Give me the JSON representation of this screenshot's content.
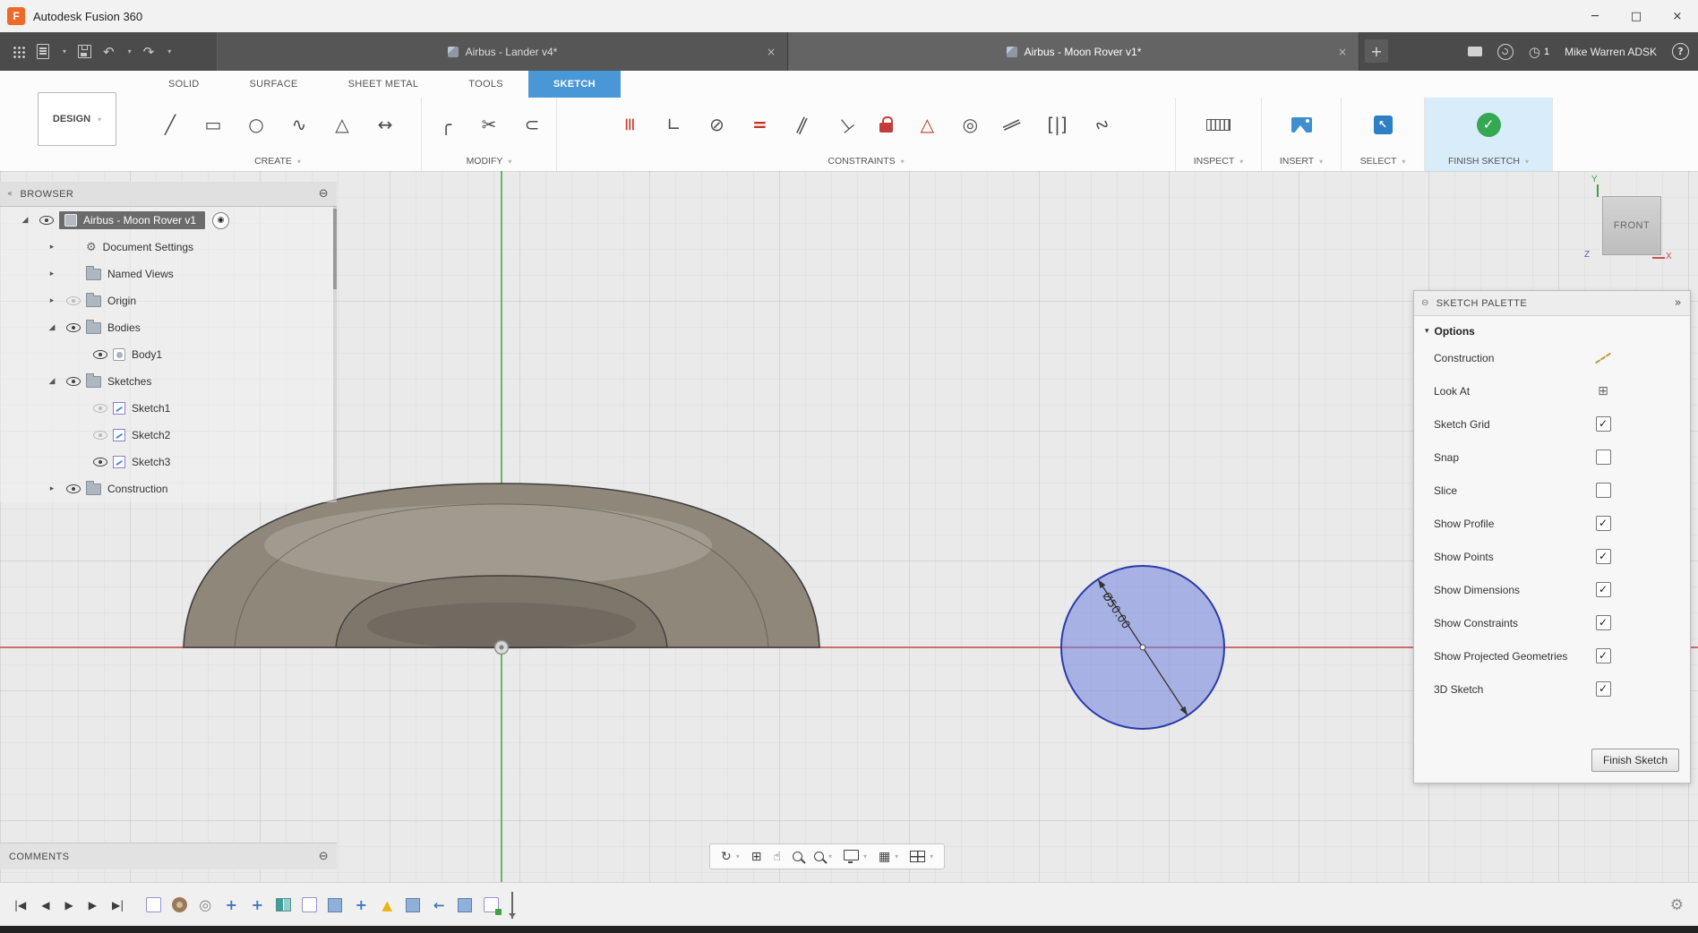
{
  "icons": {
    "minimize": "─",
    "maximize": "□",
    "close": "×",
    "browser_collapse": "«",
    "panel_collapse": "⊖",
    "palette_expand": "»",
    "dropdown_caret": "▾",
    "section_caret": "▾",
    "comments_toggle": "⊖",
    "new_tab": "+",
    "gear": "⚙"
  },
  "titlebar": {
    "logo_letter": "F",
    "app_title": "Autodesk Fusion 360"
  },
  "appbar": {
    "left_icons": [
      {
        "name": "app-launcher-icon",
        "cls": "grid9"
      },
      {
        "name": "file-new-icon",
        "cls": "file",
        "caret": true
      },
      {
        "name": "save-icon",
        "cls": "save"
      },
      {
        "name": "undo-icon",
        "glyph": "↶",
        "caret": true
      },
      {
        "name": "redo-icon",
        "glyph": "↷",
        "caret": true
      }
    ],
    "tabs": [
      {
        "label": "Airbus - Lander v4*",
        "active": false
      },
      {
        "label": "Airbus - Moon Rover v1*",
        "active": true
      }
    ],
    "right_items": [
      {
        "kind": "icon",
        "name": "comments-bubble-icon",
        "cls": "bubble"
      },
      {
        "kind": "icon",
        "name": "extensions-icon",
        "cls": "swoosh"
      },
      {
        "kind": "clock",
        "name": "job-status-icon",
        "glyph": "◷",
        "badge": "1"
      },
      {
        "kind": "user",
        "name": "user-account",
        "label": "Mike Warren ADSK"
      },
      {
        "kind": "help",
        "name": "help-icon",
        "glyph": "?"
      }
    ]
  },
  "ribbon": {
    "design_button": "DESIGN",
    "tabs": [
      {
        "label": "SOLID"
      },
      {
        "label": "SURFACE"
      },
      {
        "label": "SHEET METAL"
      },
      {
        "label": "TOOLS"
      },
      {
        "label": "SKETCH",
        "active": true
      }
    ],
    "groups": [
      {
        "key": "create",
        "label": "CREATE",
        "icons": [
          {
            "name": "line-icon",
            "glyph": "╱"
          },
          {
            "name": "rectangle-icon",
            "glyph": "▭"
          },
          {
            "name": "circle-icon",
            "glyph": "○"
          },
          {
            "name": "spline-icon",
            "glyph": "∿"
          },
          {
            "name": "polygon-icon",
            "glyph": "△"
          },
          {
            "name": "sketch-dimension-icon",
            "glyph": "↔"
          }
        ]
      },
      {
        "key": "modify",
        "label": "MODIFY",
        "icons": [
          {
            "name": "fillet-icon",
            "glyph": "╭"
          },
          {
            "name": "trim-icon",
            "glyph": "✂"
          },
          {
            "name": "offset-icon",
            "glyph": "⊂"
          }
        ]
      },
      {
        "key": "constraints",
        "label": "CONSTRAINTS",
        "icons": [
          {
            "name": "horizontal-vertical-constraint-icon",
            "glyph": "≡",
            "color": "#c0392b",
            "rot": 90
          },
          {
            "name": "coincident-constraint-icon",
            "glyph": "∟"
          },
          {
            "name": "tangent-constraint-icon",
            "glyph": "⊘"
          },
          {
            "name": "equal-constraint-icon",
            "glyph": "=",
            "color": "#c0392b",
            "bold": true
          },
          {
            "name": "parallel-constraint-icon",
            "glyph": "∥",
            "rot": 25
          },
          {
            "name": "perpendicular-constraint-icon",
            "glyph": "⊥",
            "rot": -40
          },
          {
            "name": "fix-constraint-icon",
            "cls": "lock"
          },
          {
            "name": "midpoint-constraint-icon",
            "glyph": "△",
            "color": "#c0392b"
          },
          {
            "name": "concentric-constraint-icon",
            "glyph": "◎"
          },
          {
            "name": "collinear-constraint-icon",
            "glyph": "∥",
            "rot": 65
          },
          {
            "name": "symmetry-constraint-icon",
            "glyph": "[|]"
          },
          {
            "name": "curvature-constraint-icon",
            "glyph": "∿",
            "rot": -45
          }
        ]
      },
      {
        "key": "inspect",
        "label": "INSPECT",
        "icons": [
          {
            "name": "measure-icon",
            "cls": "ruler"
          }
        ]
      },
      {
        "key": "insert",
        "label": "INSERT",
        "icons": [
          {
            "name": "insert-image-icon",
            "cls": "image"
          }
        ]
      },
      {
        "key": "select",
        "label": "SELECT",
        "icons": [
          {
            "name": "select-icon",
            "cls": "select"
          }
        ]
      },
      {
        "key": "finish",
        "label": "FINISH SKETCH",
        "highlight": true,
        "icons": [
          {
            "name": "finish-sketch-icon",
            "cls": "finish"
          }
        ]
      }
    ]
  },
  "browser": {
    "title": "BROWSER",
    "items": [
      {
        "label": "Airbus - Moon Rover v1",
        "depth": 0,
        "arrow": "expanded",
        "eye": "on",
        "icon": "component",
        "selected": true,
        "activate": true
      },
      {
        "label": "Document Settings",
        "depth": 1,
        "arrow": "collapsed",
        "icon": "gear"
      },
      {
        "label": "Named Views",
        "depth": 1,
        "arrow": "collapsed",
        "icon": "folder"
      },
      {
        "label": "Origin",
        "depth": 1,
        "arrow": "collapsed",
        "eye": "off",
        "icon": "folder"
      },
      {
        "label": "Bodies",
        "depth": 1,
        "arrow": "expanded",
        "eye": "on",
        "icon": "folder"
      },
      {
        "label": "Body1",
        "depth": 2,
        "eye": "on",
        "icon": "body"
      },
      {
        "label": "Sketches",
        "depth": 1,
        "arrow": "expanded",
        "eye": "on",
        "icon": "folder"
      },
      {
        "label": "Sketch1",
        "depth": 2,
        "eye": "off",
        "icon": "sketch"
      },
      {
        "label": "Sketch2",
        "depth": 2,
        "eye": "off",
        "icon": "sketch"
      },
      {
        "label": "Sketch3",
        "depth": 2,
        "eye": "on",
        "icon": "sketch"
      },
      {
        "label": "Construction",
        "depth": 1,
        "arrow": "collapsed",
        "eye": "on",
        "icon": "folder"
      }
    ]
  },
  "canvas": {
    "sketch_dimension": "Ø50.00",
    "viewcube_face": "FRONT",
    "axis_labels": {
      "x": "X",
      "y": "Y",
      "z": "Z"
    }
  },
  "palette": {
    "title": "SKETCH PALETTE",
    "section": "Options",
    "rows": [
      {
        "label": "Construction",
        "control": "construction-icon"
      },
      {
        "label": "Look At",
        "control": "look-at-icon"
      },
      {
        "label": "Sketch Grid",
        "control": "checkbox",
        "checked": true
      },
      {
        "label": "Snap",
        "control": "checkbox",
        "checked": false
      },
      {
        "label": "Slice",
        "control": "checkbox",
        "checked": false
      },
      {
        "label": "Show Profile",
        "control": "checkbox",
        "checked": true
      },
      {
        "label": "Show Points",
        "control": "checkbox",
        "checked": true
      },
      {
        "label": "Show Dimensions",
        "control": "checkbox",
        "checked": true
      },
      {
        "label": "Show Constraints",
        "control": "checkbox",
        "checked": true
      },
      {
        "label": "Show Projected Geometries",
        "control": "checkbox",
        "checked": true
      },
      {
        "label": "3D Sketch",
        "control": "checkbox",
        "checked": true
      }
    ],
    "finish_button": "Finish Sketch"
  },
  "comments": {
    "title": "COMMENTS"
  },
  "navbar": {
    "icons": [
      {
        "name": "orbit-icon",
        "glyph": "↻",
        "caret": true
      },
      {
        "name": "look-at-icon",
        "glyph": "⊞"
      },
      {
        "name": "pan-icon",
        "glyph": "☝"
      },
      {
        "name": "zoom-icon",
        "cls": "mag"
      },
      {
        "name": "zoom-window-icon",
        "cls": "mag",
        "caret": true
      },
      {
        "name": "display-settings-icon",
        "cls": "monitor",
        "caret": true
      },
      {
        "name": "grid-settings-icon",
        "glyph": "▦",
        "caret": true
      },
      {
        "name": "viewports-icon",
        "cls": "vp",
        "caret": true
      }
    ]
  },
  "timeline": {
    "playback": [
      {
        "name": "go-to-start-icon",
        "glyph": "|◀"
      },
      {
        "name": "step-back-icon",
        "glyph": "◀"
      },
      {
        "name": "play-icon",
        "glyph": "▶"
      },
      {
        "name": "step-forward-icon",
        "glyph": "▶"
      },
      {
        "name": "go-to-end-icon",
        "glyph": "▶|"
      }
    ],
    "features": [
      {
        "name": "sketch-feature-icon",
        "kind": "sketch"
      },
      {
        "name": "form-feature-icon",
        "kind": "form"
      },
      {
        "name": "sketch-circles-feature-icon",
        "kind": "circles"
      },
      {
        "name": "move-feature-icon",
        "kind": "move"
      },
      {
        "name": "move-feature-icon",
        "kind": "move"
      },
      {
        "name": "mirror-feature-icon",
        "kind": "mirror"
      },
      {
        "name": "sketch-feature-icon",
        "kind": "sketch"
      },
      {
        "name": "box-feature-icon",
        "kind": "cube"
      },
      {
        "name": "move-feature-icon",
        "kind": "move"
      },
      {
        "name": "warning-feature-icon",
        "kind": "warning"
      },
      {
        "name": "box-feature-icon",
        "kind": "cube"
      },
      {
        "name": "arrow-feature-icon",
        "kind": "arrow"
      },
      {
        "name": "box-feature-icon",
        "kind": "cube"
      },
      {
        "name": "active-sketch-feature-icon",
        "kind": "sketch-edit"
      }
    ]
  },
  "colors": {
    "accent_blue": "#4a97d8",
    "constraint_red": "#c0392b",
    "finish_green": "#35a854",
    "sketch_fill": "#6f82dd",
    "sketch_edge": "#2b3aa8",
    "axis_x_red": "#c05050",
    "axis_y_green": "#4faa4f",
    "body_tan": "#8f8779"
  }
}
